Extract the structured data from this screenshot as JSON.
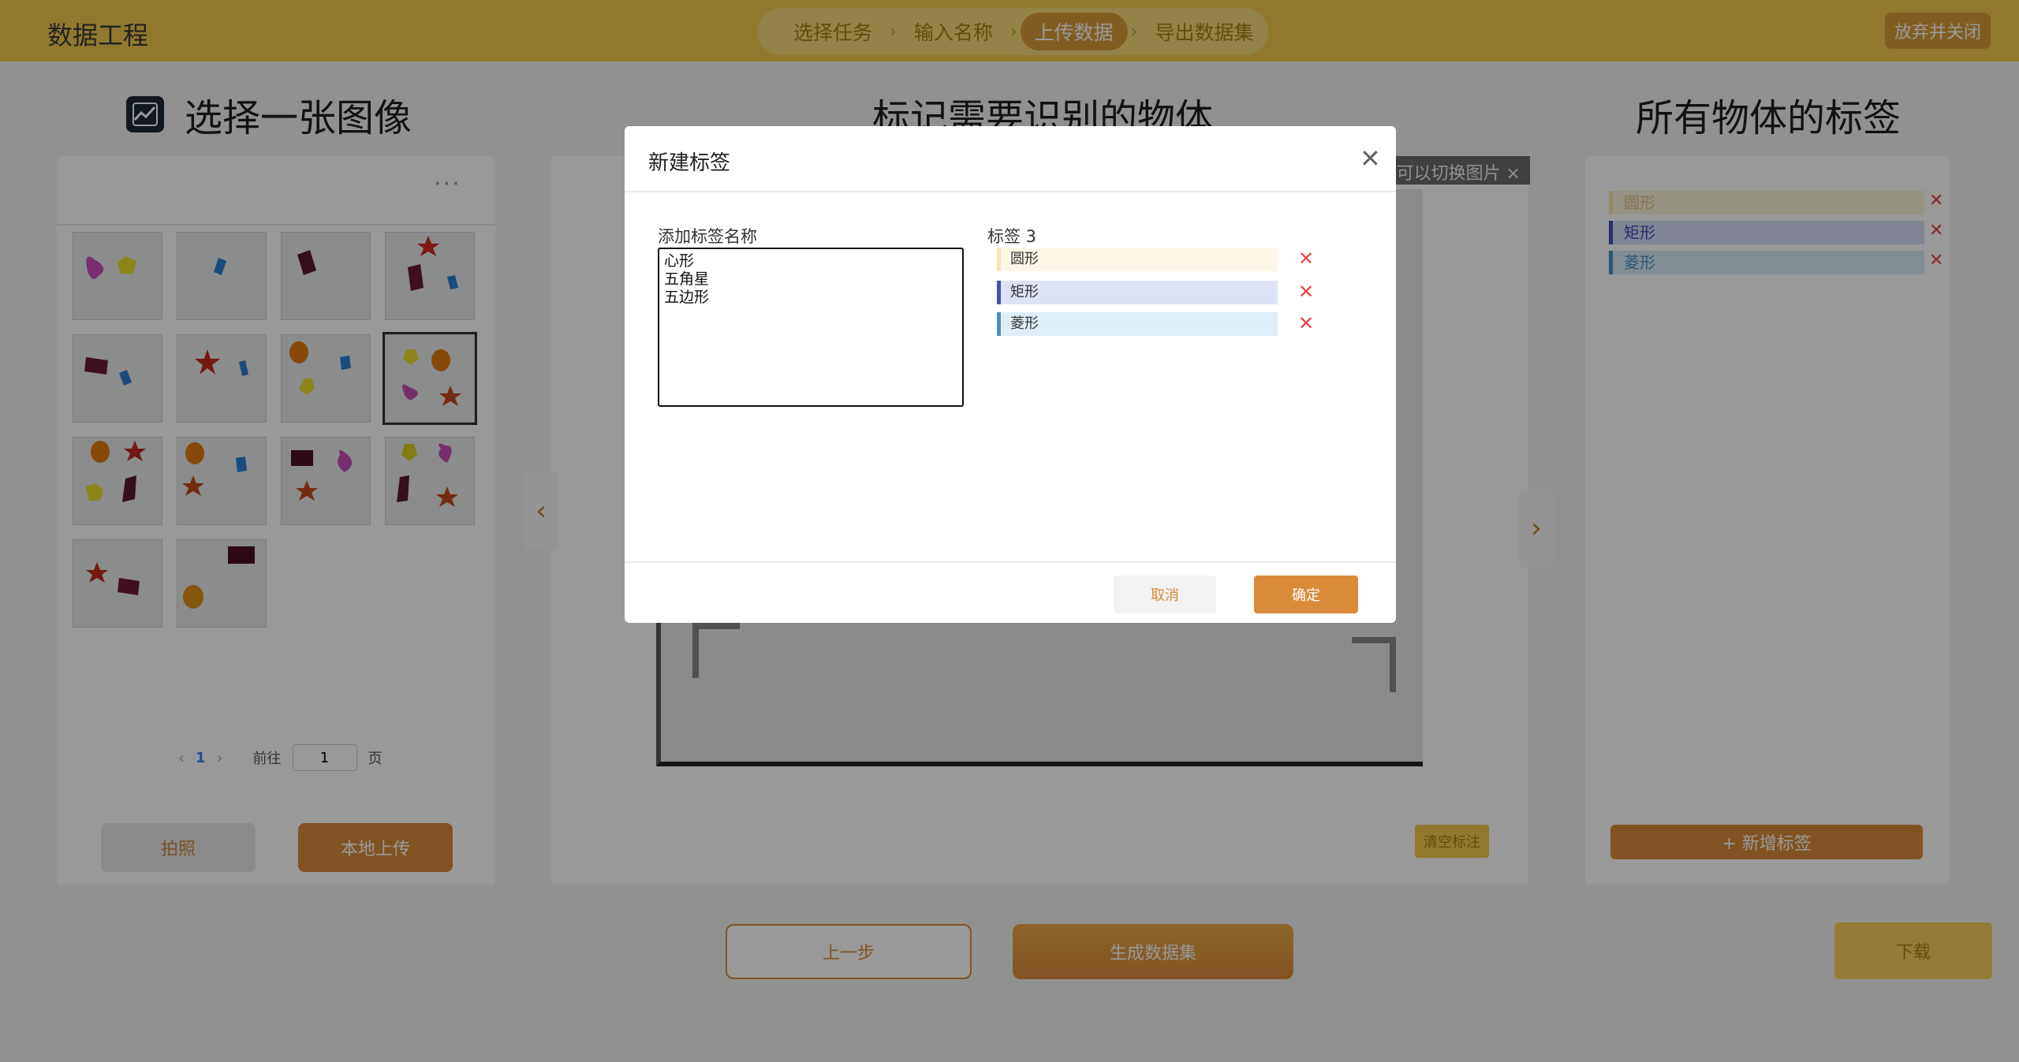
{
  "header": {
    "app_title": "数据工程",
    "steps": [
      "选择任务",
      "输入名称",
      "上传数据",
      "导出数据集"
    ],
    "active_step": 2,
    "close_button": "放弃并关闭"
  },
  "left": {
    "title": "选择一张图像",
    "more": "···",
    "pager": {
      "prev": "‹",
      "current": "1",
      "next": "›",
      "goto": "前往",
      "page_value": "1",
      "page_suffix": "页"
    },
    "photo_button": "拍照",
    "upload_button": "本地上传"
  },
  "middle": {
    "title": "标记需要识别的物体",
    "tip": "可以切换图片 ×",
    "clear_button": "清空标注",
    "prev_arrow": "‹",
    "next_arrow": "›"
  },
  "right": {
    "title": "所有物体的标签",
    "tags": [
      {
        "name": "圆形",
        "color": "#f7e7b0",
        "bg": "#fbf4dc"
      },
      {
        "name": "矩形",
        "color": "#3f51b5",
        "bg": "#d6dcf5"
      },
      {
        "name": "菱形",
        "color": "#4a90c2",
        "bg": "#d9ebf5"
      }
    ],
    "delete_icon": "✕",
    "new_tag_button": "+ 新增标签"
  },
  "footer": {
    "prev_button": "上一步",
    "generate_button": "生成数据集",
    "download_button": "下载"
  },
  "modal": {
    "title": "新建标签",
    "close": "✕",
    "input_label": "添加标签名称",
    "input_value": "心形\n五角星\n五边形",
    "tags_label": "标签 3",
    "tags": [
      {
        "name": "圆形",
        "color": "#f7e7b0",
        "bg": "#fcf7e8"
      },
      {
        "name": "矩形",
        "color": "#3f51b5",
        "bg": "#dde2f7"
      },
      {
        "name": "菱形",
        "color": "#4a90c2",
        "bg": "#e0eff7"
      }
    ],
    "delete_icon": "✕",
    "cancel_button": "取消",
    "ok_button": "确定"
  }
}
